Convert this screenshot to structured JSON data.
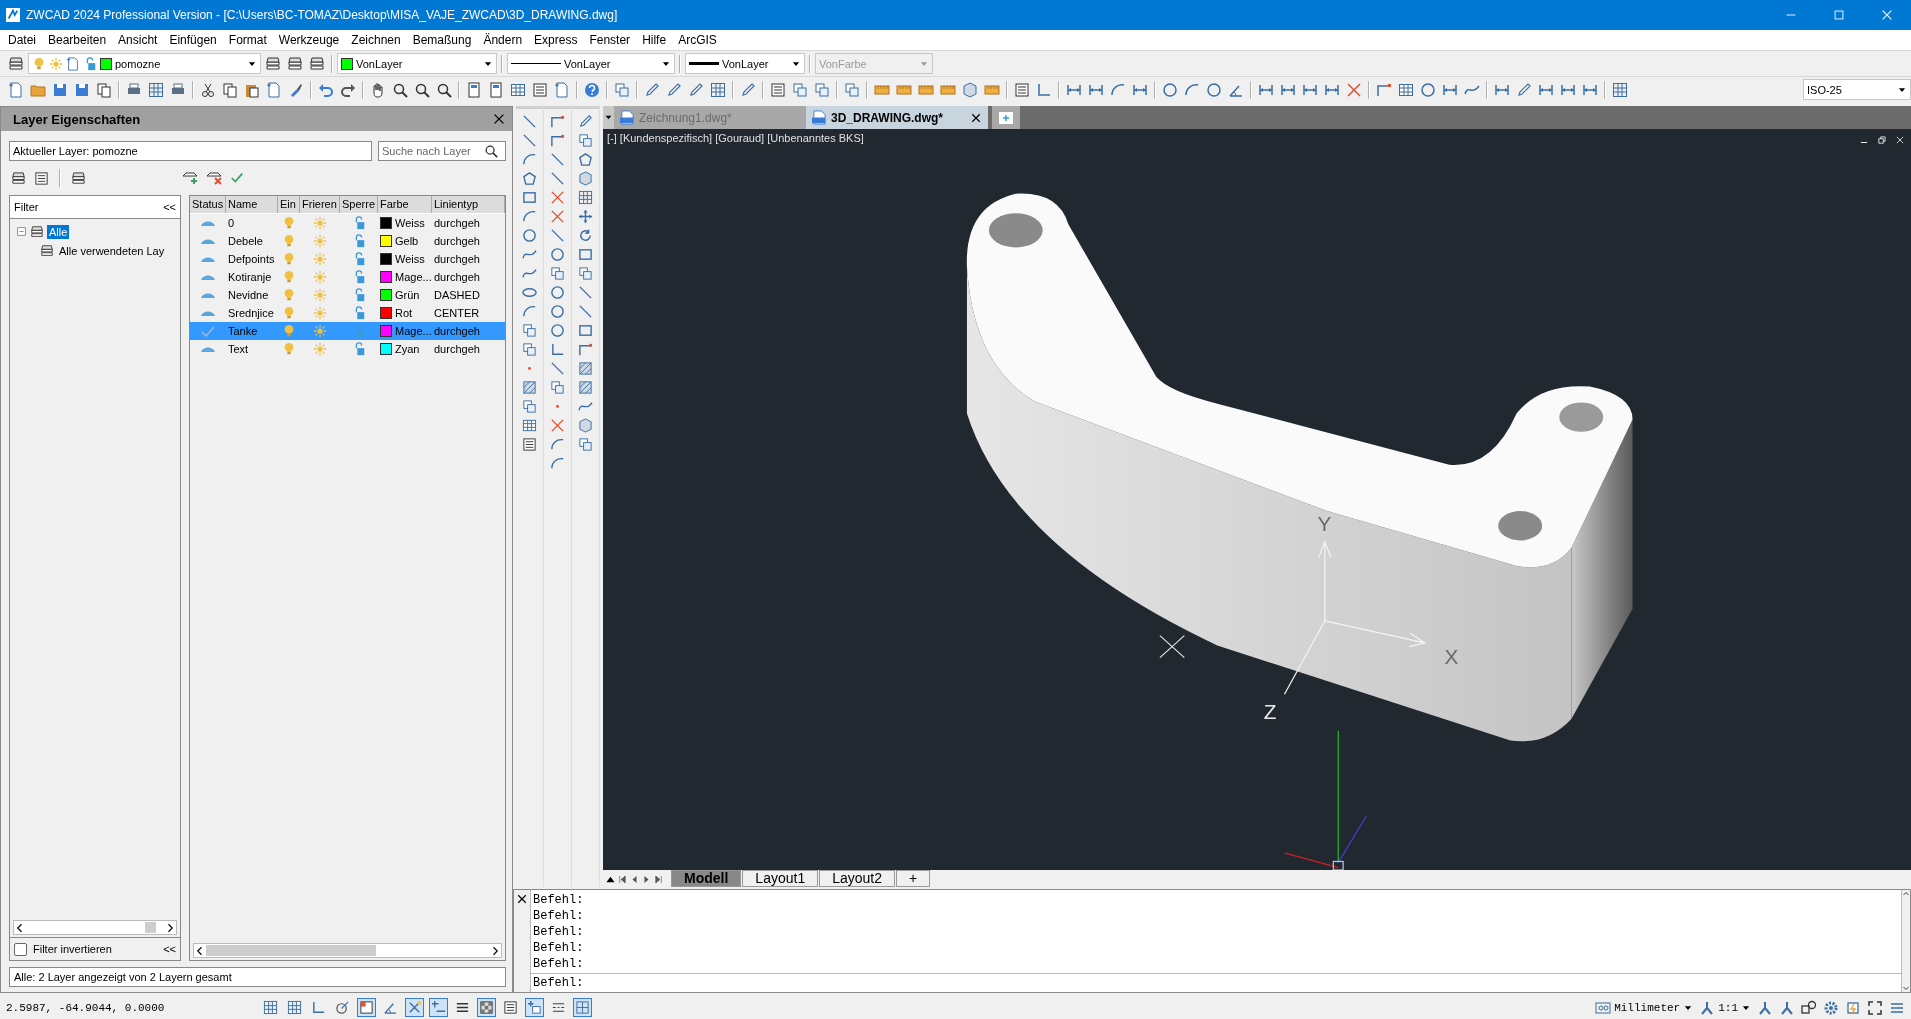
{
  "title_bar": {
    "title": "ZWCAD 2024 Professional Version - [C:\\Users\\BC-TOMAZ\\Desktop\\MISA_VAJE_ZWCAD\\3D_DRAWING.dwg]"
  },
  "menu": [
    "Datei",
    "Bearbeiten",
    "Ansicht",
    "Einfügen",
    "Format",
    "Werkzeuge",
    "Zeichnen",
    "Bemaßung",
    "Ändern",
    "Express",
    "Fenster",
    "Hilfe",
    "ArcGIS"
  ],
  "properties_toolbar": {
    "layer": {
      "value": "pomozne",
      "color": "#00ff00"
    },
    "color": {
      "value": "VonLayer",
      "color": "#00ff00"
    },
    "linetype": {
      "value": "VonLayer"
    },
    "lineweight": {
      "value": "VonLayer"
    },
    "plot_style": {
      "value": "VonFarbe",
      "disabled": true
    }
  },
  "dim_style": {
    "value": "ISO-25"
  },
  "layer_panel": {
    "title": "Layer Eigenschaften",
    "current_layer": "Aktueller Layer: pomozne",
    "search": {
      "placeholder": "Suche nach Layer"
    },
    "filter": {
      "header": "Filter",
      "collapse": "<<",
      "tree": [
        {
          "label": "Alle",
          "selected": true,
          "expanded": true,
          "children": [
            {
              "label": "Alle verwendeten Lay",
              "selected": false
            }
          ]
        }
      ],
      "invert": {
        "label": "Filter invertieren",
        "checked": false
      },
      "collapse_bottom": "<<"
    },
    "columns": [
      "Status",
      "Name",
      "Ein",
      "Frieren",
      "Sperre",
      "Farbe",
      "Linientyp"
    ],
    "rows": [
      {
        "name": "0",
        "current": false,
        "on": true,
        "frozen": false,
        "locked": false,
        "color": "#000000",
        "color_name": "Weiss",
        "linetype": "durchgeh",
        "selected": false
      },
      {
        "name": "Debele",
        "current": false,
        "on": true,
        "frozen": false,
        "locked": false,
        "color": "#ffff00",
        "color_name": "Gelb",
        "linetype": "durchgeh",
        "selected": false
      },
      {
        "name": "Defpoints",
        "current": false,
        "on": true,
        "frozen": false,
        "locked": false,
        "color": "#000000",
        "color_name": "Weiss",
        "linetype": "durchgeh",
        "selected": false
      },
      {
        "name": "Kotiranje",
        "current": false,
        "on": true,
        "frozen": false,
        "locked": false,
        "color": "#ff00ff",
        "color_name": "Mage...",
        "linetype": "durchgeh",
        "selected": false
      },
      {
        "name": "Nevidne",
        "current": false,
        "on": true,
        "frozen": false,
        "locked": false,
        "color": "#00ff00",
        "color_name": "Grün",
        "linetype": "DASHED",
        "selected": false
      },
      {
        "name": "Srednjice",
        "current": false,
        "on": true,
        "frozen": false,
        "locked": false,
        "color": "#ff0000",
        "color_name": "Rot",
        "linetype": "CENTER",
        "selected": false
      },
      {
        "name": "Tanke",
        "current": true,
        "on": true,
        "frozen": false,
        "locked": false,
        "color": "#ff00ff",
        "color_name": "Mage...",
        "linetype": "durchgeh",
        "selected": true
      },
      {
        "name": "Text",
        "current": false,
        "on": true,
        "frozen": false,
        "locked": false,
        "color": "#00ffff",
        "color_name": "Zyan",
        "linetype": "durchgeh",
        "selected": false
      }
    ],
    "status": "Alle: 2 Layer angezeigt von 2 Layern gesamt"
  },
  "doc_tabs": [
    {
      "label": "Zeichnung1.dwg*",
      "selected": false
    },
    {
      "label": "3D_DRAWING.dwg*",
      "selected": true
    }
  ],
  "viewport": {
    "header": "[-] [Kundenspezifisch] [Gouraud] [Unbenanntes BKS]",
    "axis_labels": [
      "Y",
      "X",
      "Z"
    ]
  },
  "layout_tabs": [
    {
      "label": "Modell",
      "selected": true
    },
    {
      "label": "Layout1",
      "selected": false
    },
    {
      "label": "Layout2",
      "selected": false
    },
    {
      "label": "+",
      "selected": false
    }
  ],
  "command_line": {
    "history": [
      "Befehl:",
      "Befehl:",
      "Befehl:",
      "Befehl:",
      "Befehl:"
    ],
    "prompt": "Befehl:"
  },
  "status_bar": {
    "coordinates": "2.5987, -64.9044, 0.0000",
    "toggles": [
      {
        "kind": "grid",
        "on": false
      },
      {
        "kind": "grid",
        "on": false
      },
      {
        "kind": "ortho",
        "on": false
      },
      {
        "kind": "polar",
        "on": false
      },
      {
        "kind": "snapbox",
        "on": true
      },
      {
        "kind": "angle",
        "on": false
      },
      {
        "kind": "dyn",
        "on": true
      },
      {
        "kind": "plusline",
        "on": true
      },
      {
        "kind": "lines",
        "on": false
      },
      {
        "kind": "transp",
        "on": true
      },
      {
        "kind": "list",
        "on": false
      },
      {
        "kind": "plusbox",
        "on": true
      },
      {
        "kind": "dashes",
        "on": false
      },
      {
        "kind": "select",
        "on": true
      }
    ],
    "units": "Millimeter",
    "scale": "1:1"
  }
}
